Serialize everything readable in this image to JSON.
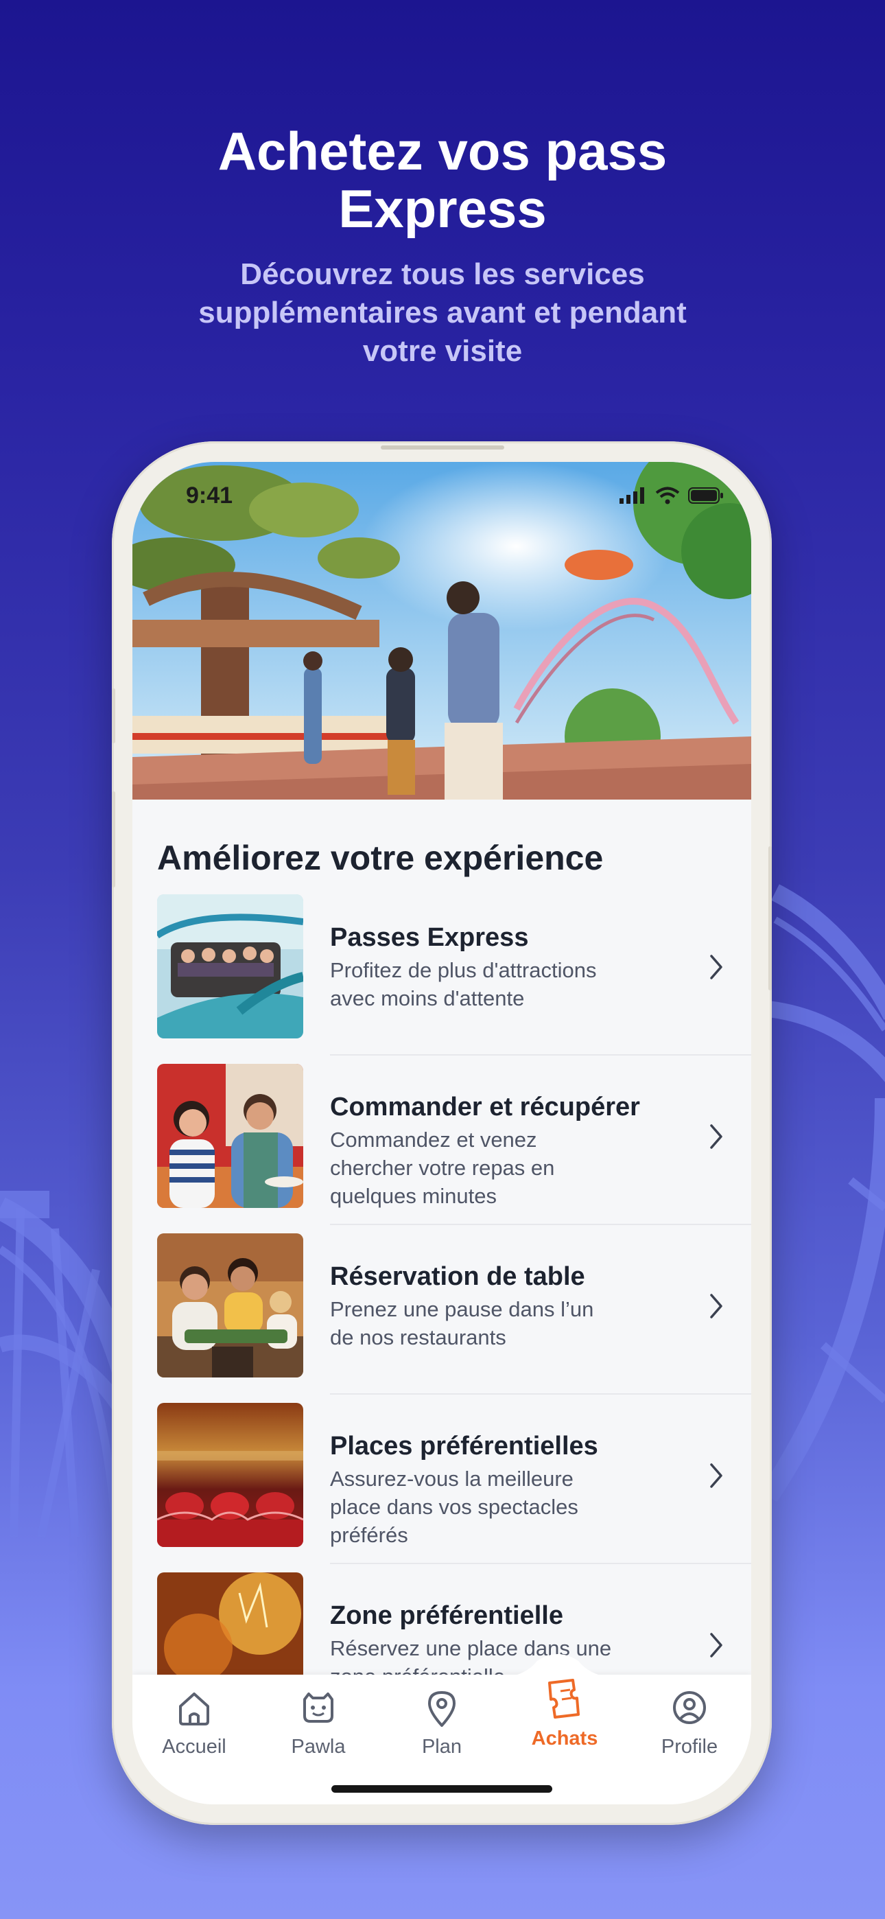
{
  "promo": {
    "title_line1": "Achetez vos pass",
    "title_line2": "Express",
    "subtitle_line1": "Découvrez tous les services",
    "subtitle_line2": "supplémentaires avant et pendant",
    "subtitle_line3": "votre visite"
  },
  "status_bar": {
    "time": "9:41"
  },
  "section": {
    "title": "Améliorez votre expérience"
  },
  "items": [
    {
      "title": "Passes Express",
      "desc": [
        "Profitez de plus d'attractions",
        "avec moins d'attente"
      ]
    },
    {
      "title": "Commander et récupérer",
      "desc": [
        "Commandez et venez",
        "chercher votre repas en",
        "quelques minutes"
      ]
    },
    {
      "title": "Réservation de table",
      "desc": [
        "Prenez une pause dans l’un",
        "de nos restaurants"
      ]
    },
    {
      "title": "Places préférentielles",
      "desc": [
        "Assurez-vous la meilleure",
        "place dans vos spectacles",
        "préférés"
      ]
    },
    {
      "title": "Zone préférentielle",
      "desc": [
        "Réservez une place dans une",
        "zone préférentielle"
      ]
    }
  ],
  "tabs": [
    {
      "label": "Accueil",
      "icon": "home-icon"
    },
    {
      "label": "Pawla",
      "icon": "mascot-icon"
    },
    {
      "label": "Plan",
      "icon": "map-pin-icon"
    },
    {
      "label": "Achats",
      "icon": "tickets-icon",
      "active": true
    },
    {
      "label": "Profile",
      "icon": "user-icon"
    }
  ],
  "colors": {
    "accent": "#ee6a27",
    "title_text": "#1d2330",
    "body_text": "#4f5566",
    "subtitle": "#c7c6f7",
    "bg_top": "#1c1590",
    "bg_bottom": "#8794f6"
  }
}
